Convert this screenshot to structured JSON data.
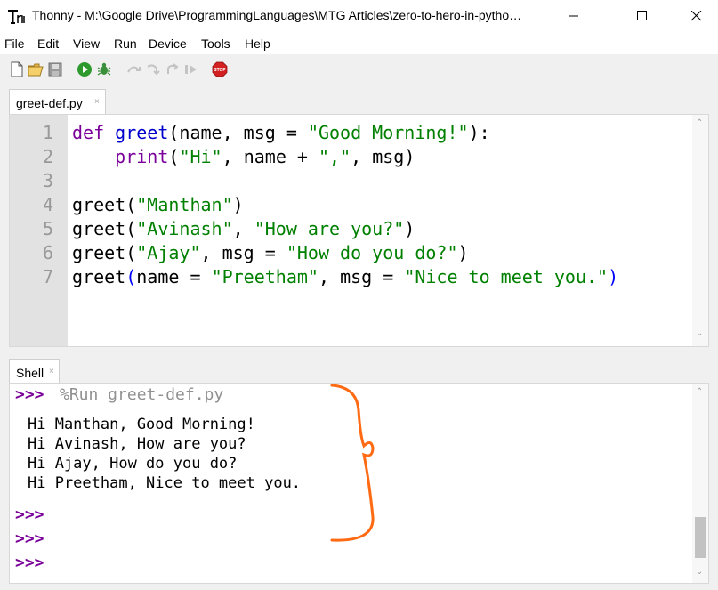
{
  "window": {
    "title": "Thonny  -  M:\\Google Drive\\ProgrammingLanguages\\MTG Articles\\zero-to-hero-in-pytho…",
    "app_icon": "thonny-logo-icon",
    "controls": [
      "minimize-icon",
      "maximize-icon",
      "close-icon"
    ]
  },
  "menu": {
    "items": [
      "File",
      "Edit",
      "View",
      "Run",
      "Device",
      "Tools",
      "Help"
    ]
  },
  "toolbar": {
    "buttons": [
      "new-file-icon",
      "open-folder-icon",
      "save-icon",
      "run-icon",
      "debug-icon",
      "step-over-icon",
      "step-into-icon",
      "step-out-icon",
      "resume-icon",
      "stop-icon"
    ],
    "stop_label": "STOP"
  },
  "editor": {
    "tab_label": "greet-def.py",
    "tab_close": "×",
    "line_numbers": [
      "1",
      "2",
      "3",
      "4",
      "5",
      "6",
      "7"
    ],
    "lines": [
      {
        "t1": "def",
        "t2": " ",
        "t3": "greet",
        "t4": "(name, msg = ",
        "t5": "\"Good Morning!\"",
        "t6": "):"
      },
      {
        "t1": "    ",
        "t2": "print",
        "t3": "(",
        "t4": "\"Hi\"",
        "t5": ", name + ",
        "t6": "\",\"",
        "t7": ", msg)"
      },
      {},
      {
        "t1": "greet(",
        "t2": "\"Manthan\"",
        "t3": ")"
      },
      {
        "t1": "greet(",
        "t2": "\"Avinash\"",
        "t3": ", ",
        "t4": "\"How are you?\"",
        "t5": ")"
      },
      {
        "t1": "greet(",
        "t2": "\"Ajay\"",
        "t3": ", msg = ",
        "t4": "\"How do you do?\"",
        "t5": ")"
      },
      {
        "t1": "greet",
        "t2": "(",
        "t3": "name = ",
        "t4": "\"Preetham\"",
        "t5": ", msg = ",
        "t6": "\"Nice to meet you.\"",
        "t7": ")"
      }
    ]
  },
  "shell": {
    "tab_label": "Shell",
    "tab_close": "×",
    "prompt": ">>>",
    "run_command": "%Run greet-def.py",
    "output": [
      "Hi Manthan, Good Morning!",
      "Hi Avinash, How are you?",
      "Hi Ajay, How do you do?",
      "Hi Preetham, Nice to meet you."
    ]
  },
  "colors": {
    "keyword": "#7a0099",
    "function_name": "#0000cc",
    "string": "#008000",
    "annotation": "#ff6a13"
  }
}
